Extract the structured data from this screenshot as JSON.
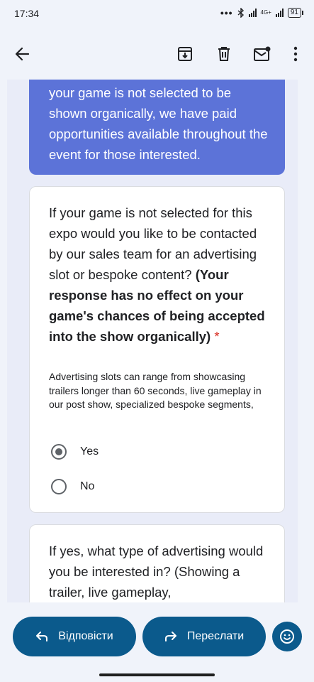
{
  "status_bar": {
    "time": "17:34",
    "dots": "•••",
    "bluetooth_icon": "bluetooth-icon",
    "signal_label": "4G+",
    "battery": "91"
  },
  "app_bar": {
    "icons": [
      "back-arrow-icon",
      "archive-icon",
      "delete-icon",
      "mark-unread-icon",
      "more-vert-icon"
    ]
  },
  "form": {
    "banner_text": "your game is not selected to be shown organically, we have paid opportunities available throughout the event for those interested.",
    "question1": {
      "text_plain": "If your game is not selected for this expo would you like to be contacted by our sales team for an advertising slot or bespoke content?",
      "text_bold": "(Your response has no effect on your game's chances of being accepted into the show organically)",
      "required_mark": "*",
      "description": "Advertising slots can range from showcasing trailers longer than 60 seconds, live gameplay in our post show, specialized bespoke segments,",
      "options": [
        {
          "label": "Yes",
          "selected": true
        },
        {
          "label": "No",
          "selected": false
        }
      ]
    },
    "question2": {
      "text": "If yes, what type of advertising would you be interested in? (Showing a trailer, live gameplay,"
    }
  },
  "actions": {
    "reply_label": "Відповісти",
    "forward_label": "Переслати",
    "emoji_icon": "emoji-reaction-icon"
  },
  "colors": {
    "banner": "#5c73d8",
    "action_button": "#0b5a8c",
    "required": "#d93025"
  }
}
